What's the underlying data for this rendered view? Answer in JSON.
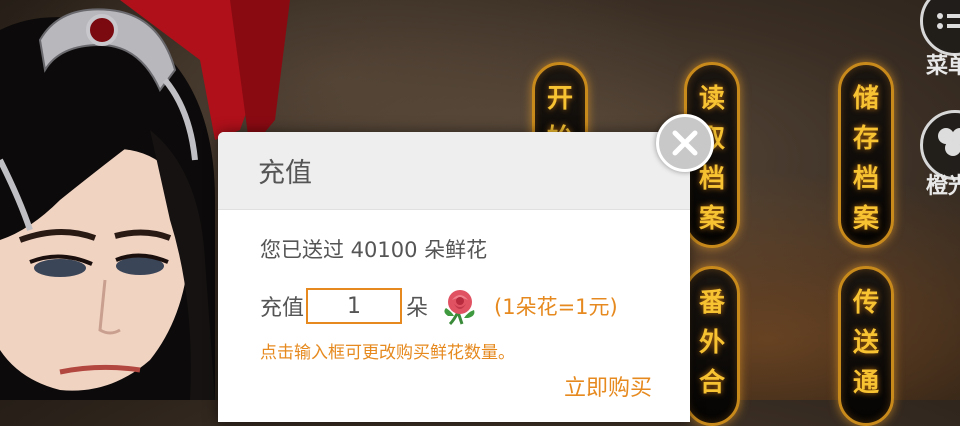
{
  "menu": {
    "buttons": [
      {
        "id": "start",
        "chars": [
          "开",
          "始"
        ]
      },
      {
        "id": "load",
        "chars": [
          "读",
          "取",
          "档",
          "案"
        ]
      },
      {
        "id": "save",
        "chars": [
          "储",
          "存",
          "档",
          "案"
        ]
      },
      {
        "id": "extra",
        "chars": [
          "番",
          "外",
          "合"
        ]
      },
      {
        "id": "teleport",
        "chars": [
          "传",
          "送",
          "通"
        ]
      }
    ]
  },
  "side": {
    "menu_label": "菜单",
    "orange_label": "橙光"
  },
  "dialog": {
    "title": "充值",
    "sent_text": "您已送过 40100 朵鲜花",
    "recharge_label": "充值",
    "quantity_value": "1",
    "unit_label": "朵",
    "rate_text": "(1朵花=1元)",
    "hint_text": "点击输入框可更改购买鲜花数量。",
    "buy_label": "立即购买"
  },
  "colors": {
    "accent": "#e68a1f",
    "menu_gold": "#f7c332",
    "dialog_header": "#eeeeee"
  },
  "icons": [
    "rose-icon",
    "close-icon",
    "menu-icon",
    "orange-logo-icon"
  ]
}
